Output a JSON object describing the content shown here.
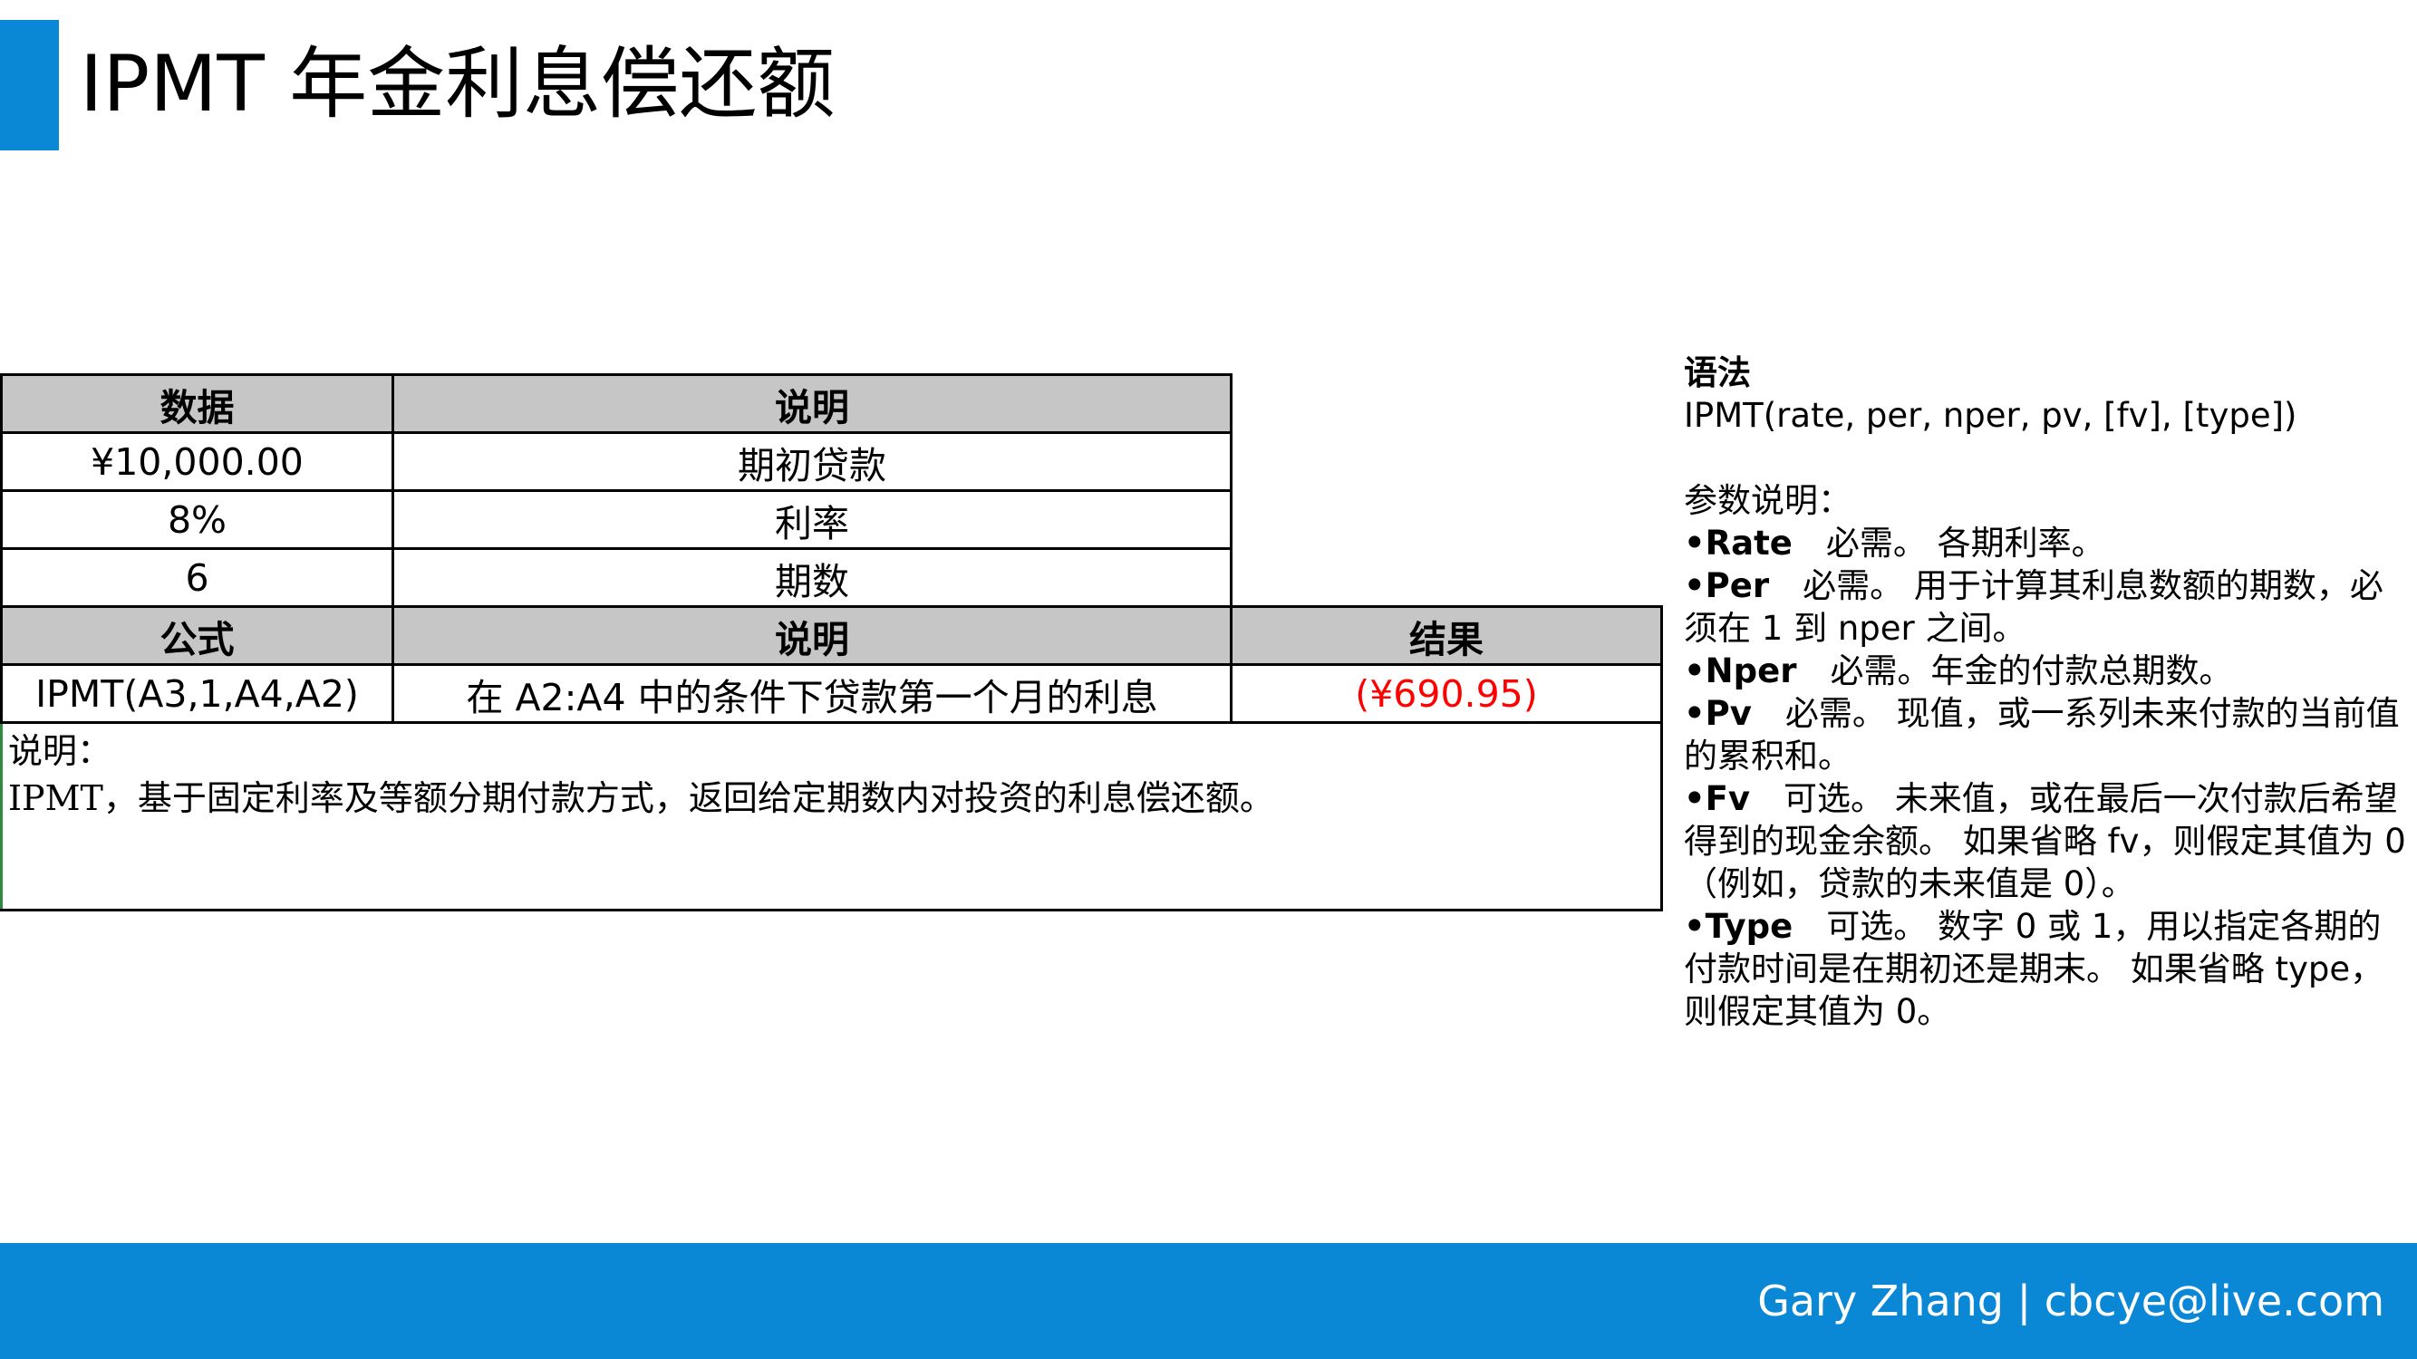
{
  "title": "IPMT 年金利息偿还额",
  "table": {
    "header1": {
      "col1": "数据",
      "col2": "说明"
    },
    "data_rows": [
      {
        "value": "¥10,000.00",
        "desc": "期初贷款"
      },
      {
        "value": "8%",
        "desc": "利率"
      },
      {
        "value": "6",
        "desc": "期数"
      }
    ],
    "header2": {
      "col1": "公式",
      "col2": "说明",
      "col3": "结果"
    },
    "formula_row": {
      "formula": "IPMT(A3,1,A4,A2)",
      "desc": "在 A2:A4 中的条件下贷款第一个月的利息",
      "result": "(¥690.95)"
    },
    "note_label": "说明：",
    "note_text": "IPMT，基于固定利率及等额分期付款方式，返回给定期数内对投资的利息偿还额。",
    "result_color": "#ff0000",
    "header_bg": "#c6c6c6"
  },
  "syntax": {
    "heading": "语法",
    "signature": "IPMT(rate, per, nper, pv, [fv], [type])",
    "params_heading": "参数说明：",
    "params": [
      {
        "name": "•Rate",
        "text": "　必需。 各期利率。"
      },
      {
        "name": "•Per",
        "text": "　必需。 用于计算其利息数额的期数，必须在 1 到 nper 之间。"
      },
      {
        "name": "•Nper",
        "text": "　必需。年金的付款总期数。"
      },
      {
        "name": "•Pv",
        "text": "　必需。 现值，或一系列未来付款的当前值的累积和。"
      },
      {
        "name": "•Fv",
        "text": "　可选。 未来值，或在最后一次付款后希望得到的现金余额。 如果省略 fv，则假定其值为 0（例如，贷款的未来值是 0）。"
      },
      {
        "name": "•Type",
        "text": "　可选。 数字 0 或 1，用以指定各期的付款时间是在期初还是期末。 如果省略 type，则假定其值为 0。"
      }
    ]
  },
  "footer": {
    "text": "Gary Zhang | cbcye@live.com"
  },
  "colors": {
    "accent": "#0a88d6",
    "footer_text": "#ffffff"
  }
}
